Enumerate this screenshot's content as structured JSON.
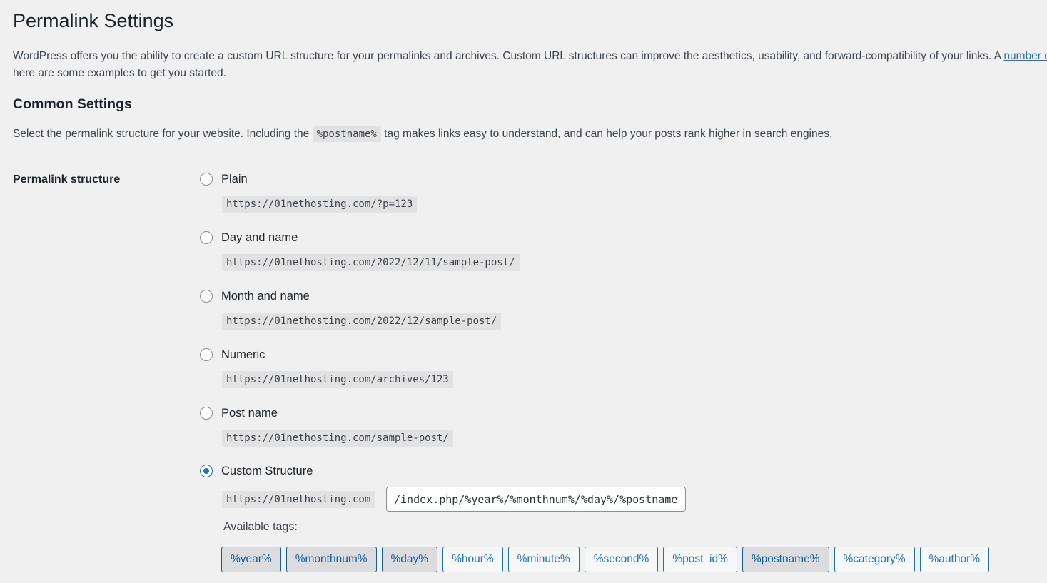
{
  "page": {
    "title": "Permalink Settings",
    "intro_text": "WordPress offers you the ability to create a custom URL structure for your permalinks and archives. Custom URL structures can improve the aesthetics, usability, and forward-compatibility of your links. A ",
    "intro_link": "number o",
    "intro_text_line2": "here are some examples to get you started."
  },
  "common": {
    "title": "Common Settings",
    "desc_before": "Select the permalink structure for your website. Including the ",
    "desc_code": "%postname%",
    "desc_after": " tag makes links easy to understand, and can help your posts rank higher in search engines."
  },
  "permalink": {
    "row_label": "Permalink structure",
    "selected": "custom",
    "options": [
      {
        "id": "plain",
        "label": "Plain",
        "example": "https://01nethosting.com/?p=123"
      },
      {
        "id": "day-name",
        "label": "Day and name",
        "example": "https://01nethosting.com/2022/12/11/sample-post/"
      },
      {
        "id": "month-name",
        "label": "Month and name",
        "example": "https://01nethosting.com/2022/12/sample-post/"
      },
      {
        "id": "numeric",
        "label": "Numeric",
        "example": "https://01nethosting.com/archives/123"
      },
      {
        "id": "post-name",
        "label": "Post name",
        "example": "https://01nethosting.com/sample-post/"
      },
      {
        "id": "custom",
        "label": "Custom Structure"
      }
    ],
    "custom_prefix": "https://01nethosting.com",
    "custom_value": "/index.php/%year%/%monthnum%/%day%/%postname%/",
    "available_tags_label": "Available tags:",
    "tags": [
      {
        "label": "%year%",
        "active": true
      },
      {
        "label": "%monthnum%",
        "active": true
      },
      {
        "label": "%day%",
        "active": true
      },
      {
        "label": "%hour%",
        "active": false
      },
      {
        "label": "%minute%",
        "active": false
      },
      {
        "label": "%second%",
        "active": false
      },
      {
        "label": "%post_id%",
        "active": false
      },
      {
        "label": "%postname%",
        "active": true
      },
      {
        "label": "%category%",
        "active": false
      },
      {
        "label": "%author%",
        "active": false
      }
    ]
  },
  "colors": {
    "accent": "#2271b1",
    "background": "#f0f0f1",
    "code_bg": "#e2e2e3"
  }
}
